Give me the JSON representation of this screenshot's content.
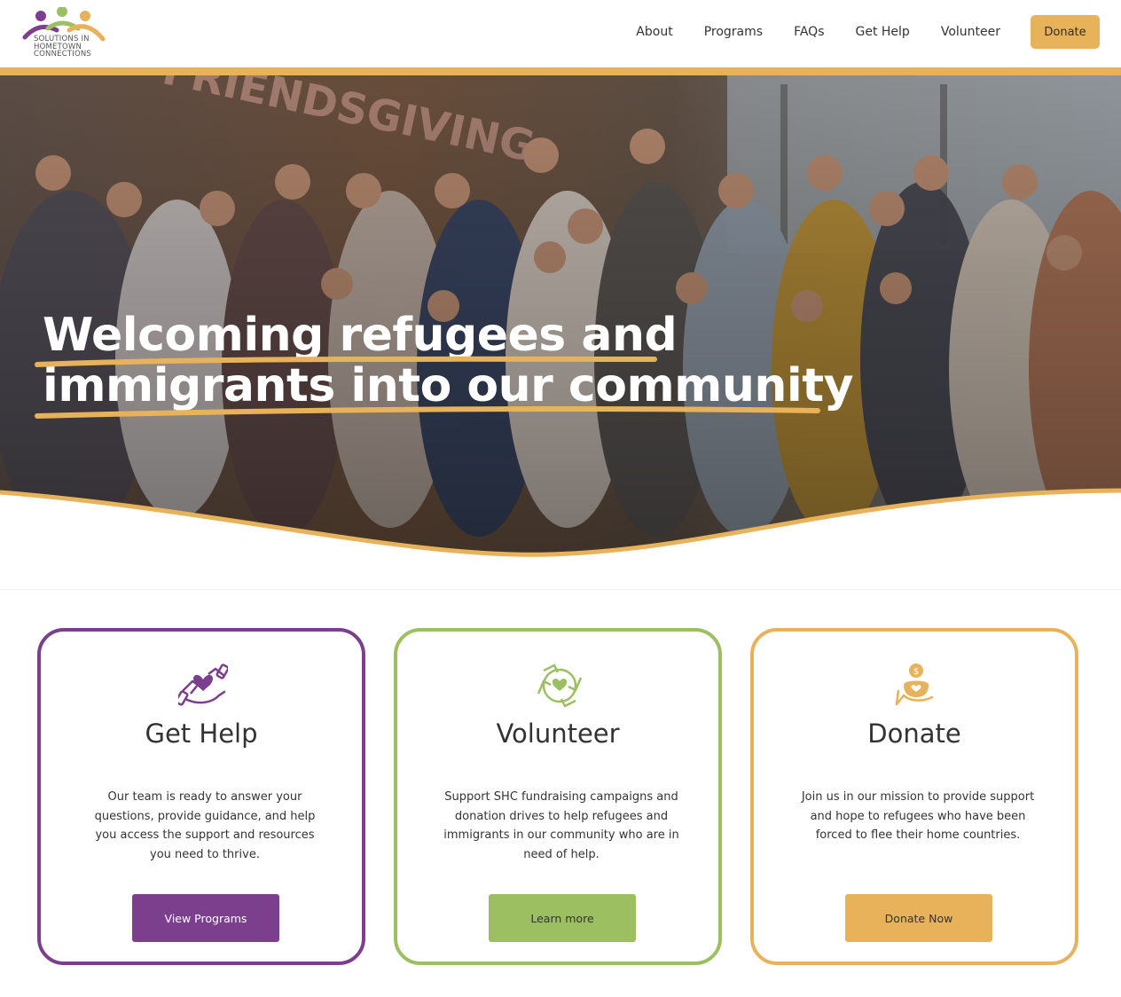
{
  "header": {
    "logo": {
      "lines": [
        "SOLUTIONS IN",
        "HOMETOWN",
        "CONNECTIONS"
      ],
      "colors": [
        "#7b3f8e",
        "#9cc061",
        "#e8b25a"
      ]
    },
    "nav": {
      "about": "About",
      "programs": "Programs",
      "faqs": "FAQs",
      "get_help": "Get Help",
      "volunteer": "Volunteer",
      "donate": "Donate"
    }
  },
  "hero": {
    "title_line1": "Welcoming refugees and",
    "title_line2": "immigrants into our community",
    "image": "group-photo-of-community-members-and-children",
    "accent_color": "#e8b25a"
  },
  "cards": [
    {
      "icon": "hands-holding-heart-icon",
      "title": "Get Help",
      "text": "Our team is ready to answer your questions, provide guidance, and help you access the support and resources you need to thrive.",
      "button": "View Programs",
      "color": "#7b3f8e"
    },
    {
      "icon": "hands-circle-heart-icon",
      "title": "Volunteer",
      "text": "Support SHC fundraising campaigns and donation drives to help refugees and immigrants in our community who are in need of help.",
      "button": "Learn more",
      "color": "#9cc061"
    },
    {
      "icon": "donation-hand-coin-icon",
      "title": "Donate",
      "text": "Join us in our mission to provide support and hope to refugees who have been forced to flee their home countries.",
      "button": "Donate Now",
      "color": "#e8b25a"
    }
  ]
}
